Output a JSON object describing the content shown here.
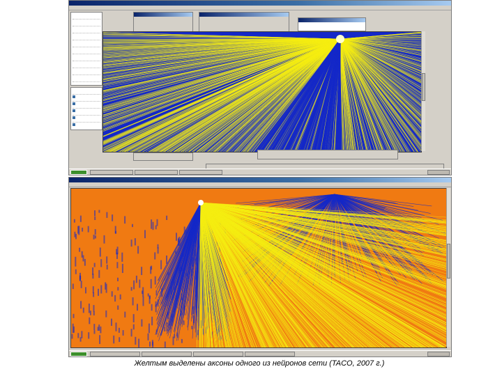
{
  "caption": "Желтым выделены аксоны одного из нейронов сети (TACO, 2007 г.)",
  "screenshots": [
    {
      "name": "top",
      "visualization": {
        "background_color": "#1428c8",
        "highlight_color": "#f5ee12"
      }
    },
    {
      "name": "bottom",
      "visualization": {
        "background_color": "#f07a12",
        "highlight_color": "#f5ee12",
        "secondary_color": "#1428c8"
      }
    }
  ],
  "colors": {
    "window_chrome": "#d4d0c8",
    "title_bar": "#0a246a",
    "axon_highlight": "#f5ee12"
  },
  "icons": [
    "start-menu-icon",
    "tray-clock-icon"
  ]
}
